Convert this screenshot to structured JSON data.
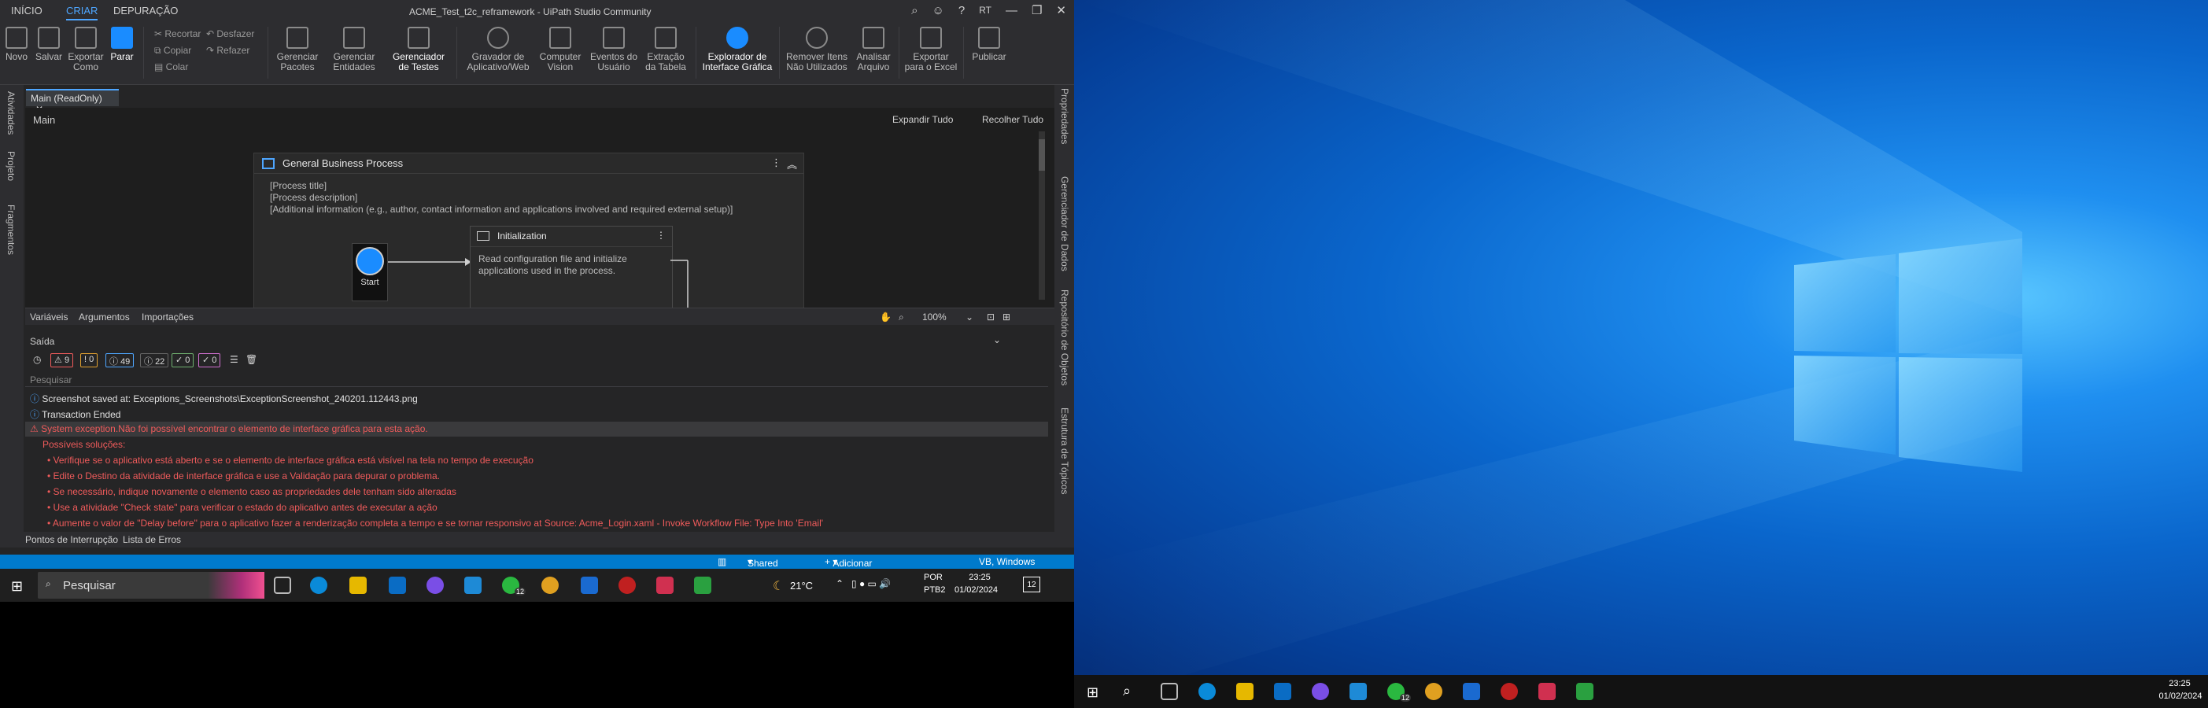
{
  "app": {
    "title": "ACME_Test_t2c_reframework - UiPath Studio Community",
    "menu_tabs": [
      "INÍCIO",
      "CRIAR",
      "DEPURAÇÃO"
    ],
    "user_initials": "RT"
  },
  "ribbon": {
    "novo": "Novo",
    "salvar": "Salvar",
    "exportar": "Exportar\nComo",
    "parar": "Parar",
    "recortar": "Recortar",
    "copiar": "Copiar",
    "colar": "Colar",
    "desfazer": "Desfazer",
    "refazer": "Refazer",
    "pacotes": "Gerenciar\nPacotes",
    "entidades": "Gerenciar\nEntidades",
    "testes": "Gerenciador\nde Testes",
    "gravador": "Gravador de\nAplicativo/Web",
    "vision": "Computer\nVision",
    "eventos": "Eventos do\nUsuário",
    "extracao": "Extração\nda Tabela",
    "explorador": "Explorador de\nInterface Gráfica",
    "remover": "Remover Itens\nNão Utilizados",
    "analisar": "Analisar\nArquivo",
    "excel": "Exportar\npara o Excel",
    "publicar": "Publicar"
  },
  "left_panels": [
    "Atividades",
    "Projeto",
    "Fragmentos"
  ],
  "right_panels": [
    "Propriedades",
    "Gerenciador de Dados",
    "Repositório de Objetos",
    "Estrutura de Tópicos"
  ],
  "doc_tab": "Main (ReadOnly)",
  "designer": {
    "breadcrumb": "Main",
    "expand_all": "Expandir Tudo",
    "collapse_all": "Recolher Tudo",
    "sequence_title": "General Business Process",
    "process_title": "[Process title]",
    "process_description": "[Process description]",
    "additional_info": "[Additional information (e.g., author, contact information and applications involved and required external setup)]",
    "init_title": "Initialization",
    "init_desc": "Read configuration file and initialize applications used in the process.",
    "start_label": "Start",
    "zoom": "100%"
  },
  "var_tabs": [
    "Variáveis",
    "Argumentos",
    "Importações"
  ],
  "output": {
    "title": "Saída",
    "counts": {
      "errors": "9",
      "warnings": "0",
      "info": "49",
      "trace": "22",
      "verbose": "0",
      "debug": "0"
    },
    "search_placeholder": "Pesquisar",
    "lines": [
      "Screenshot saved at: Exceptions_Screenshots\\ExceptionScreenshot_240201.112443.png",
      "Transaction Ended",
      "System exception.Não foi possível encontrar o elemento de interface gráfica para esta ação.",
      "Possíveis soluções:",
      "• Verifique se o aplicativo está aberto e se o elemento de interface gráfica está visível na tela no tempo de execução",
      "• Edite o Destino da atividade de interface gráfica e use a Validação para depurar o problema.",
      "• Se necessário, indique novamente o elemento caso as propriedades dele tenham sido alteradas",
      "• Use a atividade \"Check state\" para verificar o estado do aplicativo antes de executar a ação",
      "• Aumente o valor de \"Delay before\" para o aplicativo fazer a renderização completa a tempo e se tornar responsivo at Source: Acme_Login.xaml - Invoke Workflow File: Type Into 'Email'"
    ]
  },
  "bottom_tabs": [
    "Pontos de Interrupção",
    "Lista de Erros"
  ],
  "status": {
    "shared": "Shared",
    "source_control": "Adicionar ao Controle de Or...",
    "lang": "VB, Windows"
  },
  "taskbar": {
    "search_placeholder": "Pesquisar",
    "weather": "21°C",
    "lang1": "POR",
    "lang2": "PTB2",
    "time": "23:25",
    "date": "01/02/2024",
    "notif": "12",
    "whatsapp_badge": "12"
  },
  "taskbar2": {
    "time": "23:25",
    "date": "01/02/2024",
    "whatsapp_badge": "12"
  },
  "colors": {
    "accent": "#4ea6ff",
    "status_blue": "#007acc",
    "error": "#f05b5b"
  }
}
